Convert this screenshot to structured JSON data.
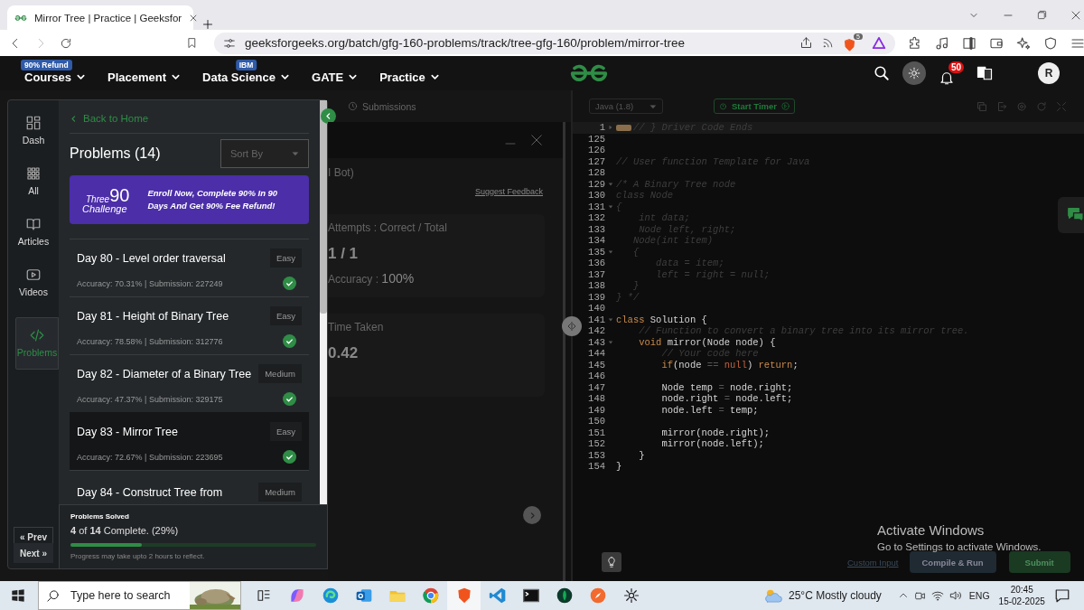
{
  "browser": {
    "tab": {
      "title": "Mirror Tree | Practice | Geeksfor",
      "selected": true
    },
    "url": "geeksforgeeks.org/batch/gfg-160-problems/track/tree-gfg-160/problem/mirror-tree",
    "shield_count": "5"
  },
  "site_nav": {
    "items": [
      {
        "label": "Courses",
        "badge": "90% Refund"
      },
      {
        "label": "Placement"
      },
      {
        "label": "Data Science",
        "badge": "IBM"
      },
      {
        "label": "GATE"
      },
      {
        "label": "Practice"
      }
    ],
    "notification_count": "50",
    "avatar": "R"
  },
  "sidebar": {
    "items": [
      {
        "label": "Dash",
        "selected": false
      },
      {
        "label": "All",
        "selected": false
      },
      {
        "label": "Articles",
        "selected": false
      },
      {
        "label": "Videos",
        "selected": false
      },
      {
        "label": "Problems",
        "selected": true
      }
    ],
    "prev": "« Prev",
    "next": "Next »"
  },
  "problems": {
    "back": "Back to Home",
    "title": "Problems (14)",
    "sort_placeholder": "Sort By",
    "banner": {
      "logo_top": "Three",
      "logo_number": "90",
      "logo_bottom": "Challenge",
      "text": "Enroll Now, Complete 90% In 90 Days And Get 90% Fee Refund!"
    },
    "items": [
      {
        "title": "Day 80 - Level order traversal",
        "difficulty": "Easy",
        "stats": "Accuracy: 70.31% | Submission: 227249",
        "solved": true,
        "selected": false
      },
      {
        "title": "Day 81 - Height of Binary Tree",
        "difficulty": "Easy",
        "stats": "Accuracy: 78.58% | Submission: 312776",
        "solved": true,
        "selected": false
      },
      {
        "title": "Day 82 - Diameter of a Binary Tree",
        "difficulty": "Medium",
        "stats": "Accuracy: 47.37% | Submission: 329175",
        "solved": true,
        "selected": false
      },
      {
        "title": "Day 83 - Mirror Tree",
        "difficulty": "Easy",
        "stats": "Accuracy: 72.67% | Submission: 223695",
        "solved": true,
        "selected": true
      },
      {
        "title": "Day 84 - Construct Tree from",
        "difficulty": "Medium",
        "selected": false
      }
    ],
    "solved": {
      "heading": "Problems Solved",
      "summary": "**4** of **14** Complete. (29%)",
      "level": 0.29,
      "note": "Progress may take upto 2 hours to reflect."
    }
  },
  "result": {
    "tab": "Submissions",
    "bot_title": "I Bot)",
    "feedback_link": "Suggest Feedback",
    "attempts": {
      "label": "Attempts : Correct / Total",
      "value": "1 / 1",
      "accuracy_label": "Accuracy :",
      "accuracy": "100%"
    },
    "time": {
      "label": "Time Taken",
      "value": "0.42"
    }
  },
  "editor": {
    "language": "Java (1.8)",
    "timer": "Start Timer",
    "custom_input": "Custom Input",
    "compile": "Compile & Run",
    "submit": "Submit",
    "lines": [
      {
        "number": "1",
        "folded": true,
        "segments": [
          {
            "kind": "comment",
            "text": "// } Driver Code Ends"
          }
        ]
      },
      {
        "number": "125"
      },
      {
        "number": "126"
      },
      {
        "number": "127",
        "segments": [
          {
            "kind": "comment",
            "text": "// User function Template for Java"
          }
        ]
      },
      {
        "number": "128"
      },
      {
        "number": "129",
        "folded": false,
        "segments": [
          {
            "kind": "comment",
            "text": "/* A Binary Tree node"
          }
        ]
      },
      {
        "number": "130",
        "segments": [
          {
            "kind": "comment",
            "text": "class Node"
          }
        ]
      },
      {
        "number": "131",
        "folded": false,
        "segments": [
          {
            "kind": "comment",
            "text": "{"
          }
        ]
      },
      {
        "number": "132",
        "segments": [
          {
            "kind": "comment",
            "text": "    int data;"
          }
        ]
      },
      {
        "number": "133",
        "segments": [
          {
            "kind": "comment",
            "text": "    Node left, right;"
          }
        ]
      },
      {
        "number": "134",
        "segments": [
          {
            "kind": "comment",
            "text": "   Node(int item)"
          }
        ]
      },
      {
        "number": "135",
        "folded": false,
        "segments": [
          {
            "kind": "comment",
            "text": "   {"
          }
        ]
      },
      {
        "number": "136",
        "segments": [
          {
            "kind": "comment",
            "text": "       data = item;"
          }
        ]
      },
      {
        "number": "137",
        "segments": [
          {
            "kind": "comment",
            "text": "       left = right = null;"
          }
        ]
      },
      {
        "number": "138",
        "segments": [
          {
            "kind": "comment",
            "text": "   }"
          }
        ]
      },
      {
        "number": "139",
        "segments": [
          {
            "kind": "comment",
            "text": "} */"
          }
        ]
      },
      {
        "number": "140"
      },
      {
        "number": "141",
        "folded": false,
        "segments": [
          {
            "kind": "keyword",
            "text": "class"
          },
          {
            "kind": "plain",
            "text": " Solution {"
          }
        ]
      },
      {
        "number": "142",
        "segments": [
          {
            "kind": "comment",
            "text": "    // Function to convert a binary tree into its mirror tree."
          }
        ]
      },
      {
        "number": "143",
        "folded": false,
        "segments": [
          {
            "kind": "keyword",
            "text": "    void"
          },
          {
            "kind": "plain",
            "text": " mirror(Node node) {"
          }
        ]
      },
      {
        "number": "144",
        "segments": [
          {
            "kind": "comment",
            "text": "        // Your code here"
          }
        ]
      },
      {
        "number": "145",
        "segments": [
          {
            "kind": "keyword",
            "text": "        if"
          },
          {
            "kind": "plain",
            "text": "(node "
          },
          {
            "kind": "operator",
            "text": "=="
          },
          {
            "kind": "literal",
            "text": " null"
          },
          {
            "kind": "plain",
            "text": ") "
          },
          {
            "kind": "keyword",
            "text": "return"
          },
          {
            "kind": "plain",
            "text": ";"
          }
        ]
      },
      {
        "number": "146"
      },
      {
        "number": "147",
        "segments": [
          {
            "kind": "plain",
            "text": "        Node temp "
          },
          {
            "kind": "operator",
            "text": "="
          },
          {
            "kind": "plain",
            "text": " node.right;"
          }
        ]
      },
      {
        "number": "148",
        "segments": [
          {
            "kind": "plain",
            "text": "        node.right "
          },
          {
            "kind": "operator",
            "text": "="
          },
          {
            "kind": "plain",
            "text": " node.left;"
          }
        ]
      },
      {
        "number": "149",
        "segments": [
          {
            "kind": "plain",
            "text": "        node.left "
          },
          {
            "kind": "operator",
            "text": "="
          },
          {
            "kind": "plain",
            "text": " temp;"
          }
        ]
      },
      {
        "number": "150"
      },
      {
        "number": "151",
        "segments": [
          {
            "kind": "plain",
            "text": "        mirror(node.right);"
          }
        ]
      },
      {
        "number": "152",
        "segments": [
          {
            "kind": "plain",
            "text": "        mirror(node.left);"
          }
        ]
      },
      {
        "number": "153",
        "segments": [
          {
            "kind": "plain",
            "text": "    }"
          }
        ]
      },
      {
        "number": "154",
        "segments": [
          {
            "kind": "plain",
            "text": "}"
          }
        ]
      }
    ]
  },
  "activation": {
    "title": "Activate Windows",
    "subtitle": "Go to Settings to activate Windows."
  },
  "taskbar": {
    "search_placeholder": "Type here to search",
    "weather": "25°C Mostly cloudy",
    "language": "ENG",
    "time": "20:45",
    "date": "15-02-2025"
  }
}
